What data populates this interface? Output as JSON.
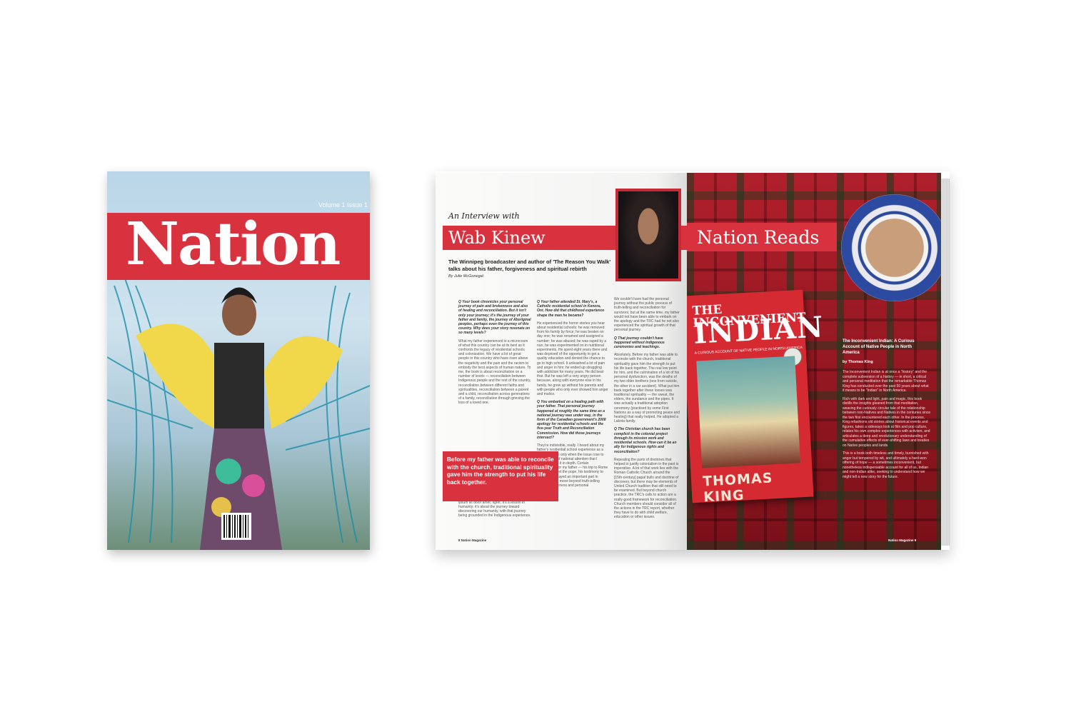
{
  "cover": {
    "title": "Nation",
    "issue": "Volume 1 Issue 1"
  },
  "interview": {
    "kicker": "An Interview with",
    "headline": "Wab Kinew",
    "dek": "The Winnipeg broadcaster and author of 'The Reason You Walk' talks about his father, forgiveness and spiritual rebirth",
    "byline": "By Julie McGonegal",
    "col1": {
      "q1": "Q Your book chronicles your personal journey of pain and brokenness and also of healing and reconciliation. But it isn't only your journey; it's the journey of your father and family, the journey of Aboriginal peoples, perhaps even the journey of this country. Why does your story resonate on so many levels?",
      "a1": "What my father experienced is a microcosm of what this country can be at its best as it confronts the legacy of residential schools and colonization. We have a lot of great people in this country who have risen above the negativity and the pain and the racism to embody the best aspects of human nature. To me, the book is about reconciliation on a number of levels — reconciliation between Indigenous people and the rest of the country, reconciliation between different faiths and spiritualities, reconciliation between a parent and a child, reconciliation across generations of a family, reconciliation through grieving the loss of a loved one.",
      "a2": "I hope people who read this book recognize that while it is told through an Indigenous lens, it's not an Indigenous story. Lorem ipsum sit dolor amet. Ilgret. It's a lesson in humanity; it's about the journey toward discovering our humanity, with that journey being grounded in the Indigenous experience."
    },
    "col2": {
      "q1": "Q Your father attended St. Mary's, a Catholic residential school in Kenora, Ont. How did that childhood experience shape the man he became?",
      "a1": "He experienced the horror stories you hear about residential schools: he was removed from his family by force; he was beaten on day one; he was renamed and assigned a number; he was abused; he was raped by a nun; he was experimented on in nutritional experiments. He spent eight years there and was deprived of the opportunity to get a quality education and denied the chance to go to high school. It unleashed a lot of pain and anger in him; he ended up struggling with addiction for many years. He did beat that. But he was left a very angry person because, along with everyone else in his family, he grew up without his parents and with people who only ever showed him anger and malice.",
      "q2": "Q You embarked on a healing path with your father. That personal journey happened at roughly the same time as a national journey was under way, in the form of the Canadian government's 2008 apology for residential schools and the five-year Truth and Reconciliation Commission. How did those journeys intersect?",
      "a2": "They're indivisible, really. I heard about my father's residential school experience as a boy, but it was only when the issue rose to the forefront of national attention that I learned about it in depth. Certain experiences for my father — his trip to Rome in 2009 to meet the pope, his testimony to the TRC — played an important part in allowing us to move beyond truth-telling toward forgiveness and personal reconciliation."
    },
    "col3": {
      "a1": "We couldn't have had the personal journey without the public process of truth-telling and reconciliation for survivors; but at the same time, my father would not have been able to embark on the apology and the TRC had he not also experienced the spiritual growth of that personal journey.",
      "q1": "Q That journey couldn't have happened without Indigenous ceremonies and teachings.",
      "a2": "Absolutely. Before my father was able to reconcile with the church, traditional spirituality gave him the strength to put his life back together. The real low point for him, and the culmination of a lot of his personal dysfunction, was the deaths of my two older brothers (one from suicide, the other in a car accident). What put him back together after these losses was traditional spirituality — the sweat, the elders, the sundance and the pipes. It was actually a traditional adoption ceremony (practised by some First Nations as a way of promoting peace and healing) that really helped. He adopted a Lakota family.",
      "q2": "Q The Christian church has been complicit in the colonial project through its mission work and residential schools. How can it be an ally for Indigenous rights and reconciliation?",
      "a3": "Repealing the parts of doctrines that helped to justify colonialism in the past is imperative. A lot of that work lies with the Roman Catholic Church around the [15th-century] papal bulls and doctrine of discovery, but there may be elements of United Church tradition that still need to be examined. But beyond church practice, the TRC's calls to action are a really good framework for reconciliation. Church members should consider all of the actions in the TRC report, whether they have to do with child welfare, education or other issues."
    },
    "pullquote": "Before my father was able to reconcile with the church, traditional spirituality gave him the strength to put his life back together.",
    "folio": "8 Nation Magazine"
  },
  "reads": {
    "title": "Nation Reads",
    "book": {
      "top": "THE INCONVENIENT",
      "big": "INDIAN",
      "sub": "A CURIOUS ACCOUNT OF NATIVE PEOPLE IN NORTH AMERICA",
      "author": "THOMAS KING"
    },
    "heading": "The Inconvenient Indian: A Curious Account of Native People in North America",
    "by": "by Thomas King",
    "p1": "The Inconvenient Indian is at once a \"history\" and the complete subversion of a history — in short, a critical and personal meditation that the remarkable Thomas King has conducted over the past 50 years about what it means to be \"Indian\" in North America.",
    "p2": "Rich with dark and light, pain and magic, this book distills the insights gleaned from that meditation, weaving the curiously circular tale of the relationship between non-Natives and Natives in the centuries since the two first encountered each other. In the process, King refashions old stories about historical events and figures, takes a sideways look at film and pop culture, relates his own complex experiences with activism, and articulates a deep and revolutionary understanding of the cumulative effects of ever-shifting laws and treaties on Native peoples and lands.",
    "p3": "This is a book both timeless and timely, burnished with anger but tempered by wit, and ultimately a hard-won offering of hope — a sometimes inconvenient, but nonetheless indispensable account for all of us, Indian and non-Indian alike, seeking to understand how we might tell a new story for the future.",
    "folio": "Nation Magazine 9"
  }
}
